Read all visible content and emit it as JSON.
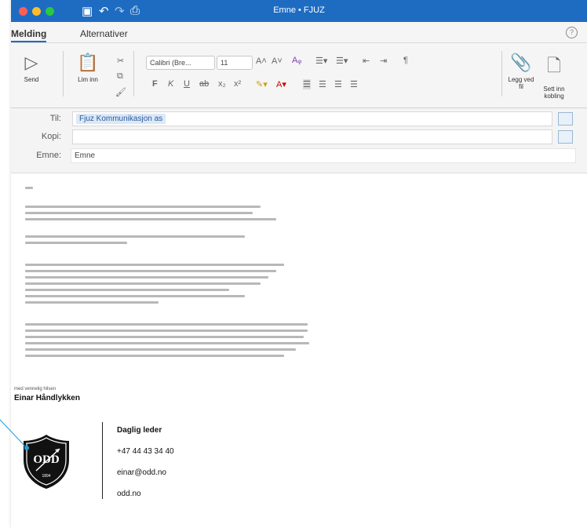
{
  "window": {
    "title": "Emne • FJUZ"
  },
  "tabs": [
    {
      "label": "Melding",
      "active": true
    },
    {
      "label": "Alternativer",
      "active": false
    }
  ],
  "ribbon": {
    "send_label": "Send",
    "paste_label": "Lim inn",
    "font_name": "Calibri (Bre...",
    "font_size": "11",
    "attach_label": "Legg ved fil",
    "insert_link_label": "Sett inn kobling"
  },
  "fields": {
    "to_label": "Til:",
    "to_value": "Fjuz Kommunikasjon as",
    "cc_label": "Kopi:",
    "cc_value": "",
    "subject_label": "Emne:",
    "subject_value": "Emne"
  },
  "signature": {
    "intro": "med vennelig hilsen",
    "name": "Einar Håndlykken",
    "role": "Daglig leder",
    "phone": "+47 44 43 34 40",
    "email": "einar@odd.no",
    "web": "odd.no",
    "logo_text": "ODD",
    "logo_year": "1894"
  },
  "colors": {
    "titlebar": "#1e6cc2",
    "accent": "#1e6cc2",
    "pointer": "#1ea0d8"
  }
}
